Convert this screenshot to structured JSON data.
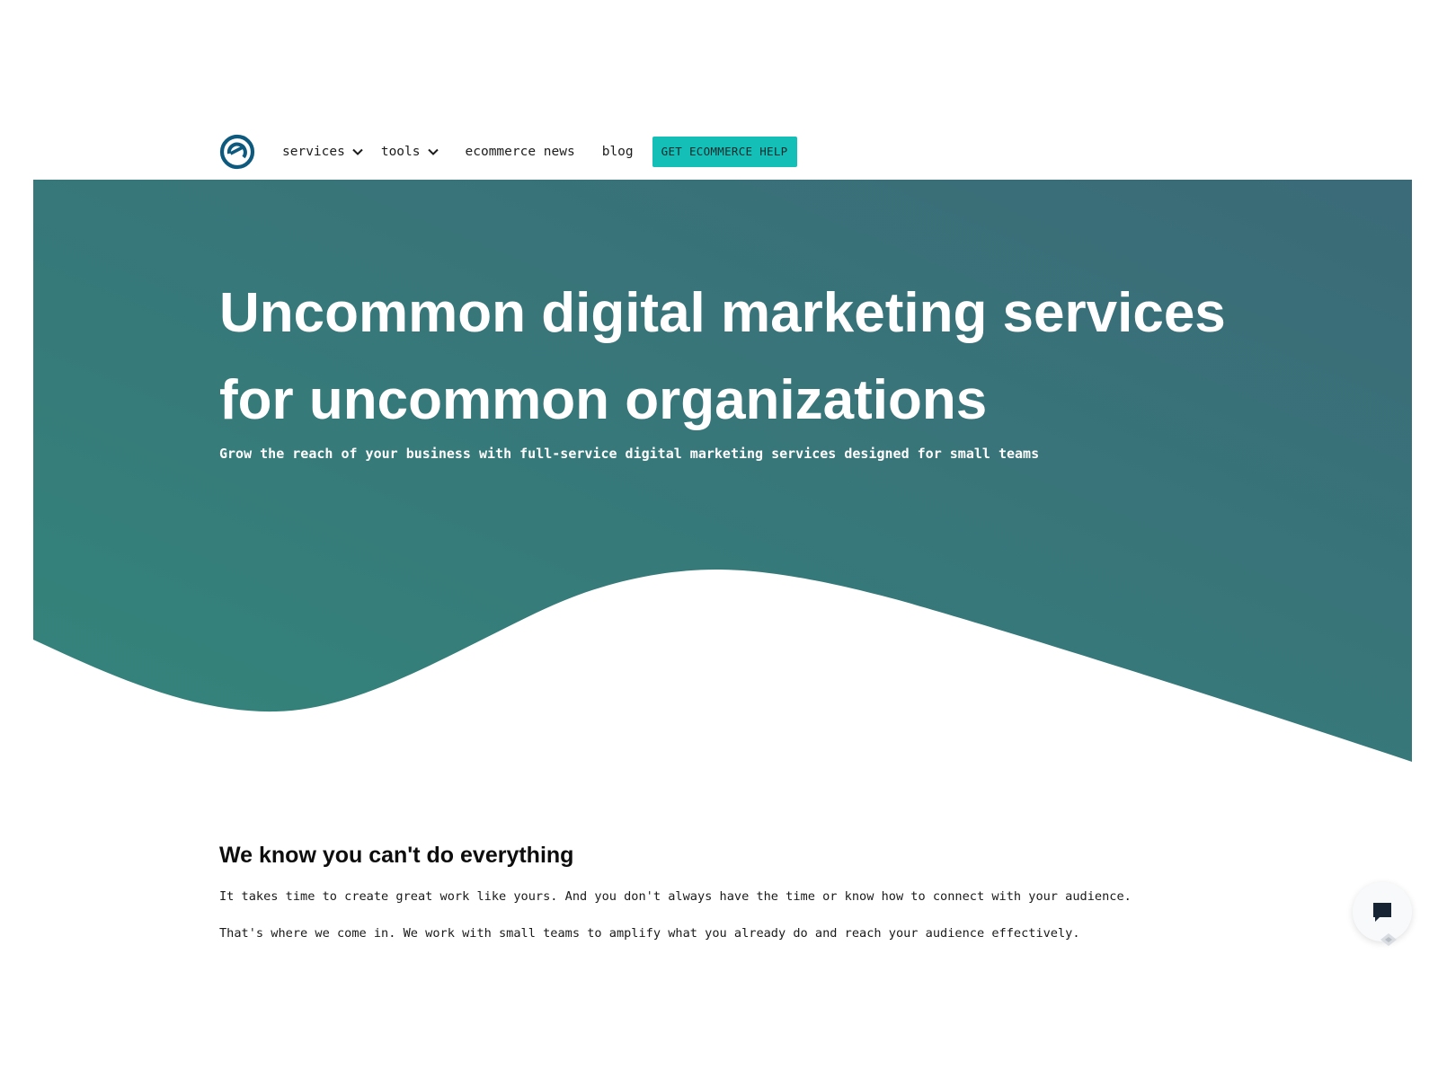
{
  "header": {
    "logo_icon": "ecommerce-e-logo",
    "nav": {
      "services_label": "services",
      "tools_label": "tools",
      "news_label": "ecommerce news",
      "blog_label": "blog"
    },
    "cta_label": "GET ECOMMERCE HELP"
  },
  "hero": {
    "title": "Uncommon digital marketing services for uncommon organizations",
    "subtitle": "Grow the reach of your business with full-service digital marketing services designed for small teams"
  },
  "intro": {
    "heading": "We know you can't do everything",
    "paragraphs": [
      "It takes time to create great work like yours. And you don't always have the time or know how to connect with your audience.",
      "That's where we come in. We work with small teams to amplify what you already do and reach your audience effectively."
    ]
  },
  "chat_widget": {
    "icon": "chat-bubble-icon",
    "badge_icon": "widget-badge-icon"
  },
  "colors": {
    "hero_gradient_start": "#33857b",
    "hero_gradient_end": "#3b6a78",
    "cta_background": "#14bfb8",
    "logo": "#0e5a7e"
  }
}
